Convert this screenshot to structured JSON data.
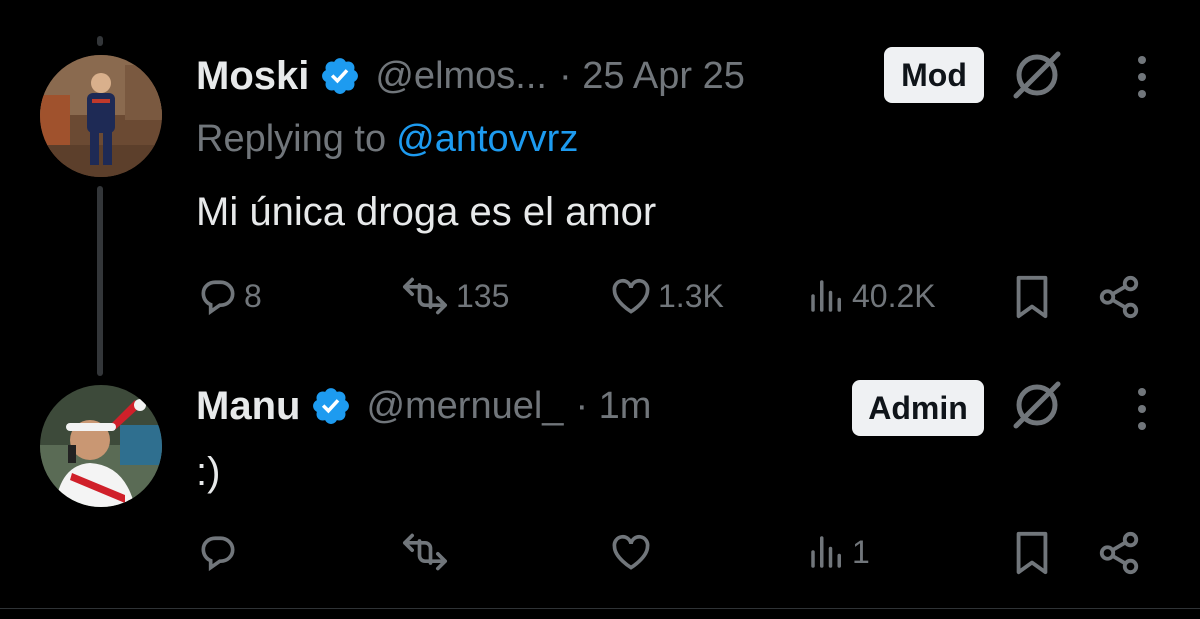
{
  "tweets": [
    {
      "display_name": "Moski",
      "handle": "@elmos...",
      "separator_time": "· 25 Apr 25",
      "role_badge": "Mod",
      "replying_prefix": "Replying to",
      "replying_to": "@antovvrz",
      "text": "Mi única droga es el amor",
      "stats": {
        "replies": "8",
        "reposts": "135",
        "likes": "1.3K",
        "views": "40.2K"
      }
    },
    {
      "display_name": "Manu",
      "handle": "@mernuel_",
      "separator_time": "· 1m",
      "role_badge": "Admin",
      "text": ":)",
      "stats": {
        "replies": "",
        "reposts": "",
        "likes": "",
        "views": "1"
      }
    }
  ],
  "icons": {
    "verified": "verified-badge-icon",
    "grok": "grok-icon",
    "more": "more-vertical-icon",
    "reply": "reply-icon",
    "repost": "repost-icon",
    "like": "heart-icon",
    "views": "views-chart-icon",
    "bookmark": "bookmark-icon",
    "share": "share-icon"
  },
  "colors": {
    "background": "#000000",
    "primary_text": "#e7e9ea",
    "secondary_text": "#71767b",
    "accent_blue": "#1d9bf0",
    "badge_bg": "#eff1f3"
  }
}
